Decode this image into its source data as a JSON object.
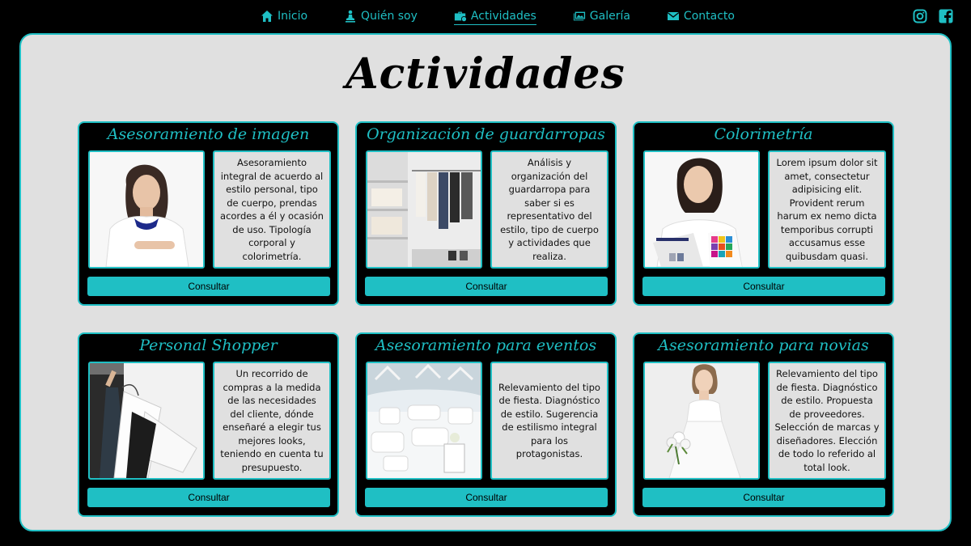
{
  "nav": {
    "items": [
      {
        "label": "Inicio",
        "icon": "home-icon"
      },
      {
        "label": "Quién soy",
        "icon": "person-icon"
      },
      {
        "label": "Actividades",
        "icon": "briefcase-icon",
        "active": true
      },
      {
        "label": "Galería",
        "icon": "gallery-icon"
      },
      {
        "label": "Contacto",
        "icon": "envelope-icon"
      }
    ],
    "social": [
      "instagram-icon",
      "facebook-icon"
    ],
    "accent": "#1fbfc4"
  },
  "page": {
    "title": "Actividades"
  },
  "cards": [
    {
      "title": "Asesoramiento de imagen",
      "description": "Asesoramiento integral de acuerdo al estilo personal, tipo de cuerpo, prendas acordes a él y ocasión de uso. Tipología corporal y colorimetría.",
      "button": "Consultar"
    },
    {
      "title": "Organización de guardarropas",
      "description": "Análisis y organización del guardarropa para saber si es representativo del estilo, tipo de cuerpo y actividades que realiza.",
      "button": "Consultar"
    },
    {
      "title": "Colorimetría",
      "description": "Lorem ipsum dolor sit amet, consectetur adipisicing elit. Provident rerum harum ex nemo dicta temporibus corrupti accusamus esse quibusdam quasi.",
      "button": "Consultar"
    },
    {
      "title": "Personal Shopper",
      "description": "Un recorrido de compras a la medida de las necesidades del cliente, dónde enseñaré a elegir tus mejores looks, teniendo en cuenta tu presupuesto.",
      "button": "Consultar"
    },
    {
      "title": "Asesoramiento para eventos",
      "description": "Relevamiento del tipo de fiesta. Diagnóstico de estilo. Sugerencia de estilismo integral para los protagonistas.",
      "button": "Consultar"
    },
    {
      "title": "Asesoramiento para novias",
      "description": "Relevamiento del tipo de fiesta. Diagnóstico de estilo. Propuesta de proveedores. Selección de marcas y diseñadores. Elección de todo lo referido al total look.",
      "button": "Consultar"
    }
  ]
}
